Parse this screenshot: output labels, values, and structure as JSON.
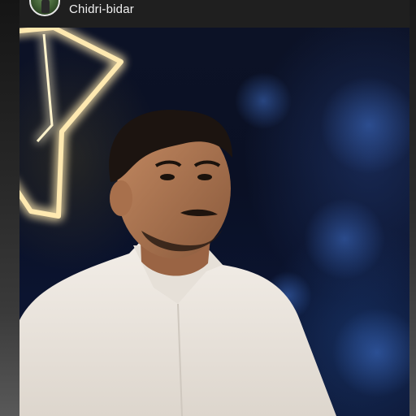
{
  "post_header": {
    "location": "Chidri-bidar",
    "avatar_icon": "profile-avatar-icon"
  },
  "photo": {
    "icon": "neon-star-icon"
  },
  "colors": {
    "header_bg": "#1f1f1f",
    "header_text": "#f2f2f2",
    "neon_star": "#ffe9b0",
    "shirt": "#efe9e2"
  }
}
